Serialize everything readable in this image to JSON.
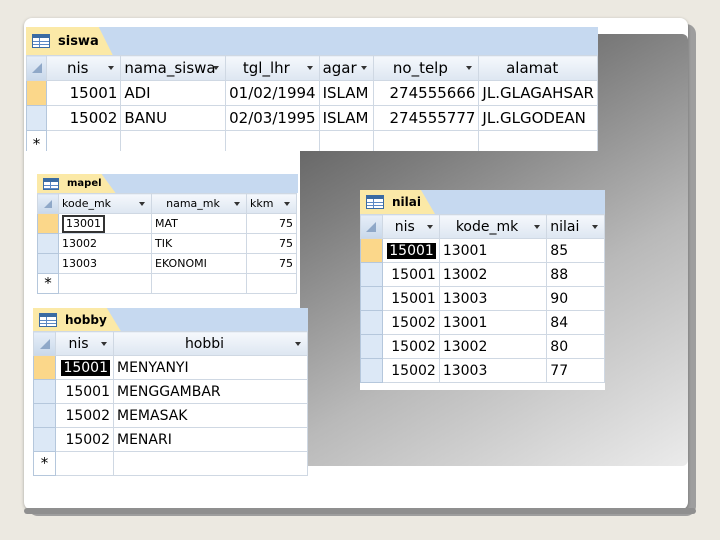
{
  "tables": {
    "siswa": {
      "tab_label": "siswa",
      "columns": [
        "nis",
        "nama_siswa",
        "tgl_lhr",
        "agar",
        "no_telp",
        "alamat"
      ],
      "rows": [
        [
          "15001",
          "ADI",
          "01/02/1994",
          "ISLAM",
          "274555666",
          "JL.GLAGAHSAR"
        ],
        [
          "15002",
          "BANU",
          "02/03/1995",
          "ISLAM",
          "274555777",
          "JL.GLGODEAN"
        ]
      ],
      "new_row_marker": "*"
    },
    "mapel": {
      "tab_label": "mapel",
      "columns": [
        "kode_mk",
        "nama_mk",
        "kkm"
      ],
      "rows": [
        [
          "13001",
          "MAT",
          "75"
        ],
        [
          "13002",
          "TIK",
          "75"
        ],
        [
          "13003",
          "EKONOMI",
          "75"
        ]
      ],
      "new_row_marker": "*"
    },
    "hobby": {
      "tab_label": "hobby",
      "columns": [
        "nis",
        "hobbi"
      ],
      "rows": [
        [
          "15001",
          "MENYANYI"
        ],
        [
          "15001",
          "MENGGAMBAR"
        ],
        [
          "15002",
          "MEMASAK"
        ],
        [
          "15002",
          "MENARI"
        ]
      ],
      "new_row_marker": "*"
    },
    "nilai": {
      "tab_label": "nilai",
      "columns": [
        "nis",
        "kode_mk",
        "nilai"
      ],
      "rows": [
        [
          "15001",
          "13001",
          "85"
        ],
        [
          "15001",
          "13002",
          "88"
        ],
        [
          "15001",
          "13003",
          "90"
        ],
        [
          "15002",
          "13001",
          "84"
        ],
        [
          "15002",
          "13002",
          "80"
        ],
        [
          "15002",
          "13003",
          "77"
        ]
      ]
    }
  },
  "colors": {
    "tab_bg": "#fbe9a7",
    "tab_strip": "#c6d9f0",
    "selector_current": "#fbd78a",
    "selector": "#dce8f6"
  }
}
